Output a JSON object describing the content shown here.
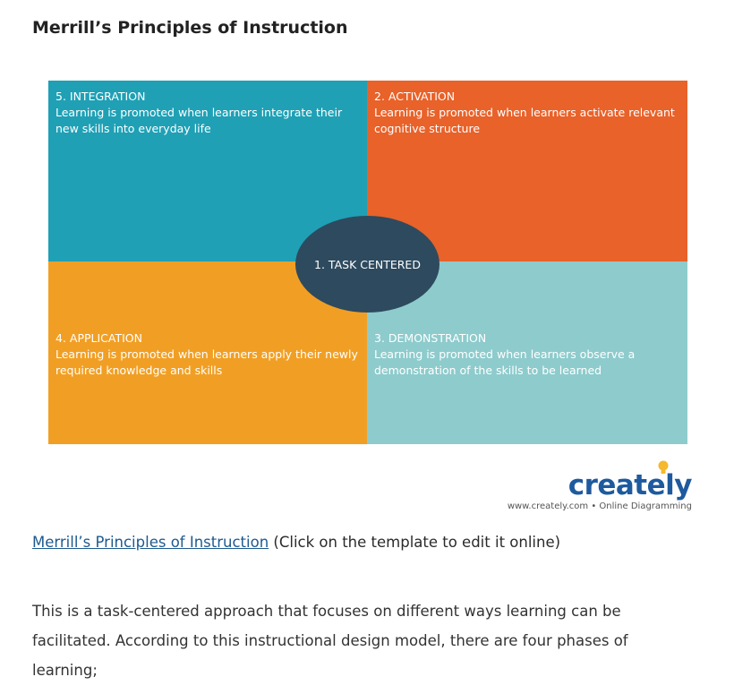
{
  "page": {
    "title": "Merrill’s Principles of Instruction"
  },
  "diagram": {
    "center": {
      "label": "1. TASK CENTERED",
      "color": "#2e4a5e"
    },
    "quadrants": [
      {
        "key": "integration",
        "title": "5. INTEGRATION",
        "description": "Learning is promoted when learners integrate their new skills into everyday life",
        "color": "#1fa0b5"
      },
      {
        "key": "activation",
        "title": "2. ACTIVATION",
        "description": "Learning is promoted when learners activate relevant cognitive structure",
        "color": "#e8622a"
      },
      {
        "key": "application",
        "title": "4. APPLICATION",
        "description": "Learning is promoted when learners apply their newly required knowledge and skills",
        "color": "#f19f24"
      },
      {
        "key": "demonstration",
        "title": "3. DEMONSTRATION",
        "description": "Learning is promoted when learners observe a demonstration of the skills to be learned",
        "color": "#8ecbcc"
      }
    ]
  },
  "logo": {
    "wordmark": "creately",
    "tagline": "www.creately.com • Online Diagramming",
    "color": "#1e5a9e",
    "bulb_color": "#f5b82e"
  },
  "caption": {
    "link_text": "Merrill’s Principles of Instruction",
    "note": " (Click on the template to edit it online)"
  },
  "body": {
    "paragraph": "This is a task-centered approach that focuses on different ways learning can be facilitated. According to this instructional design model, there are four phases of learning;"
  }
}
